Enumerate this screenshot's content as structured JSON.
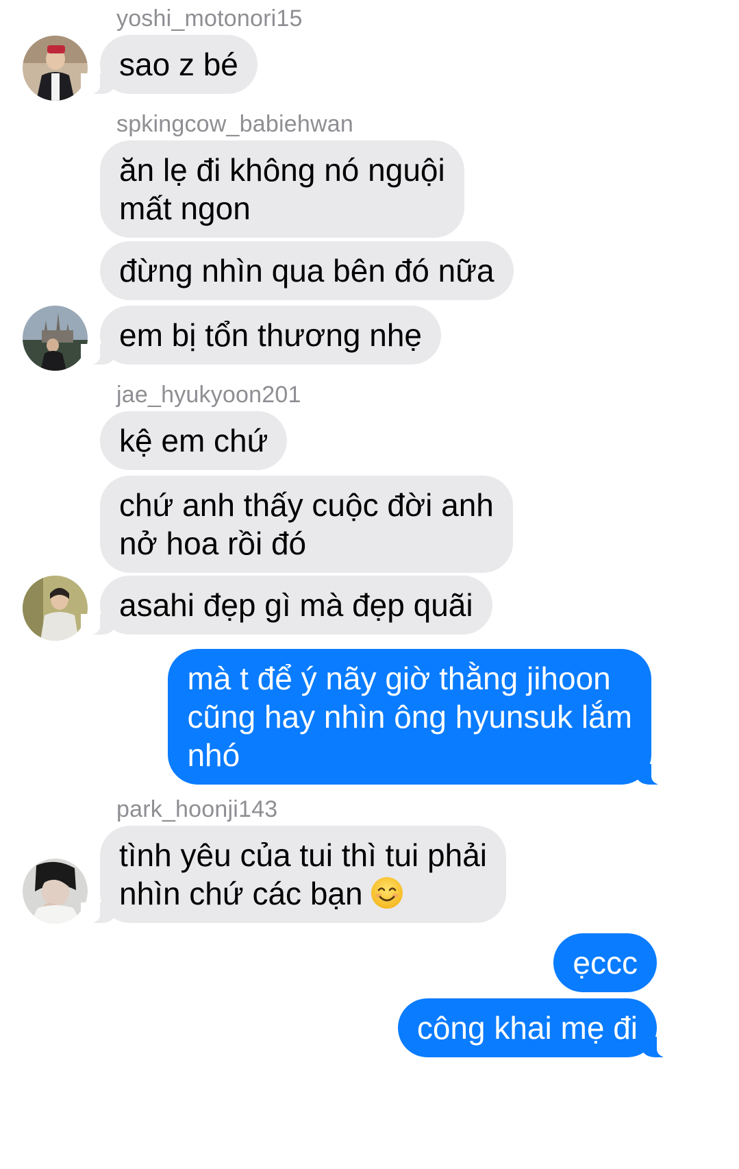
{
  "conversation": {
    "groups": [
      {
        "sender": "yoshi_motonori15",
        "messages": [
          "sao z bé"
        ]
      },
      {
        "sender": "spkingcow_babiehwan",
        "messages": [
          [
            "ăn lẹ đi không nó nguội",
            "mất ngon"
          ],
          "đừng nhìn qua bên đó nữa",
          "em bị tổn thương nhẹ"
        ]
      },
      {
        "sender": "jae_hyukyoon201",
        "messages": [
          "kệ em chứ",
          [
            "chứ anh thấy cuộc đời anh",
            "nở hoa rồi đó"
          ],
          "asahi đẹp gì mà đẹp quãi"
        ]
      },
      {
        "sender": "park_hoonji143",
        "messages": [
          [
            "tình yêu của tui thì tui phải",
            "nhìn chứ các bạn"
          ]
        ]
      }
    ],
    "outgoing": {
      "first": [
        "mà t để ý nãy giờ thằng jihoon",
        "cũng hay nhìn ông hyunsuk lắm",
        "nhó"
      ],
      "second": "ẹccc",
      "third": "công khai mẹ đi"
    },
    "emoji": "smiling-face-icon"
  },
  "colors": {
    "incoming_bubble": "#e9e9eb",
    "outgoing_bubble": "#0a7cff",
    "sender_name": "#8e8e93"
  }
}
